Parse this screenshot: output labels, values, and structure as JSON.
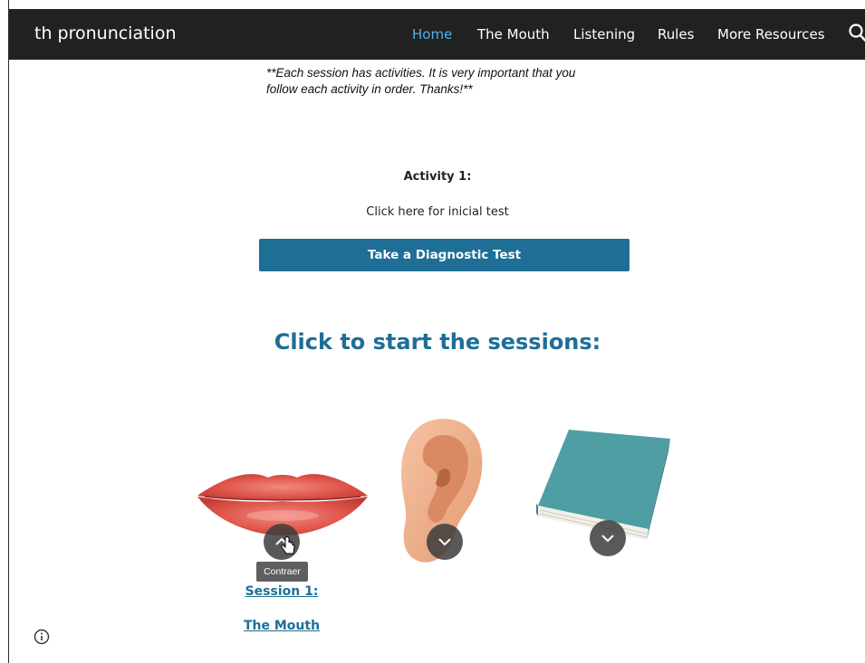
{
  "header": {
    "site_title": "th pronunciation",
    "nav": [
      {
        "label": "Home",
        "active": true
      },
      {
        "label": "The Mouth",
        "active": false
      },
      {
        "label": "Listening",
        "active": false
      },
      {
        "label": "Rules",
        "active": false
      },
      {
        "label": "More Resources",
        "active": false
      }
    ],
    "search_icon": "search-icon"
  },
  "main": {
    "note_line1": "**Each session has activities. It is very important that you",
    "note_line2": "follow each activity in order. Thanks!**",
    "activity_label": "Activity 1:",
    "activity_desc": "Click here for inicial test",
    "diagnostic_button": "Take a Diagnostic Test",
    "sessions_heading": "Click to start the sessions:",
    "tooltip": "Contraer",
    "session_title": "Session 1:",
    "session_name": "The Mouth"
  },
  "colors": {
    "accent": "#1e6e95",
    "nav_active": "#4fb3e8",
    "navbar_bg": "#212121"
  }
}
